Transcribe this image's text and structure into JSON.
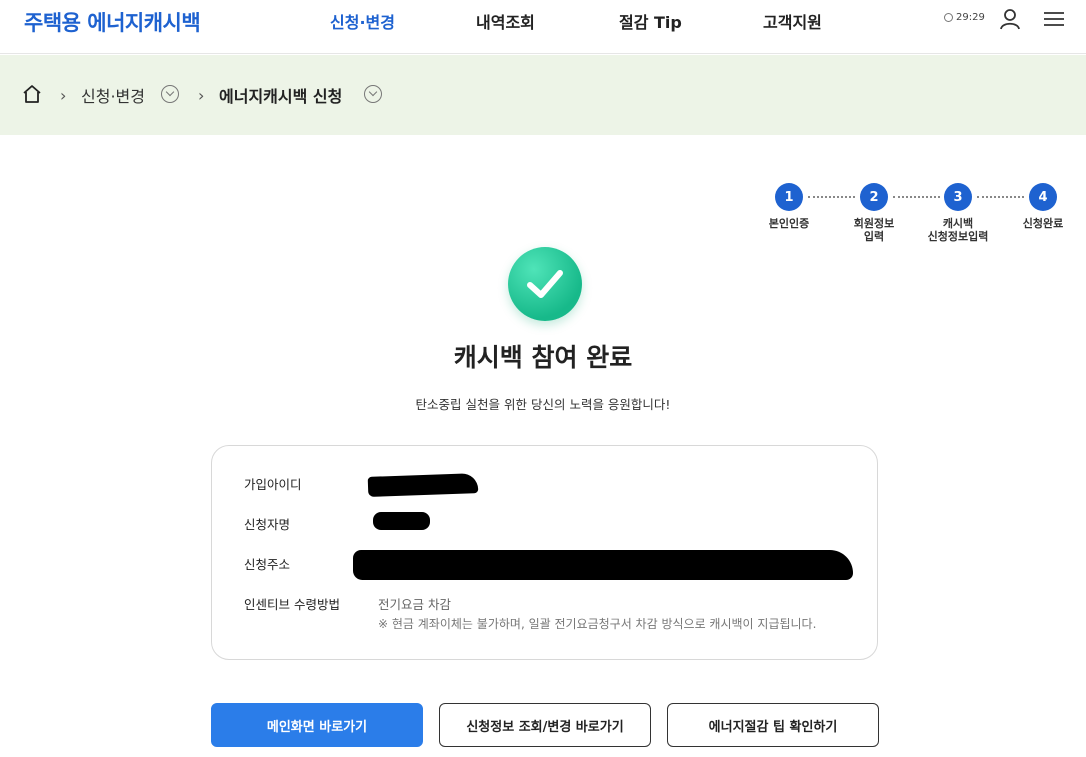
{
  "header": {
    "logo": "주택용 에너지캐시백",
    "nav": [
      "신청·변경",
      "내역조회",
      "절감 Tip",
      "고객지원"
    ],
    "timer": "29:29"
  },
  "breadcrumb": {
    "items": [
      "신청·변경",
      "에너지캐시백 신청"
    ]
  },
  "steps": [
    {
      "number": "1",
      "label": "본인인증"
    },
    {
      "number": "2",
      "label": "회원정보\n입력"
    },
    {
      "number": "3",
      "label": "캐시백\n신청정보입력"
    },
    {
      "number": "4",
      "label": "신청완료"
    }
  ],
  "result": {
    "title": "캐시백 참여 완료",
    "subtitle": "탄소중립 실천을 위한 당신의 노력을 응원합니다!"
  },
  "info": {
    "labels": [
      "가입아이디",
      "신청자명",
      "신청주소",
      "인센티브 수령방법"
    ],
    "incentive_method": "전기요금 차감",
    "incentive_note": "※ 현금 계좌이체는 불가하며, 일괄 전기요금청구서 차감 방식으로 캐시백이 지급됩니다."
  },
  "buttons": {
    "main": "메인화면 바로가기",
    "lookup": "신청정보 조회/변경 바로가기",
    "tips": "에너지절감 팁 확인하기"
  },
  "colors": {
    "brand": "#1e62d0",
    "breadcrumb_bg": "#edf4e7",
    "success": "#17b98a",
    "primary_button": "#2b7de9"
  }
}
